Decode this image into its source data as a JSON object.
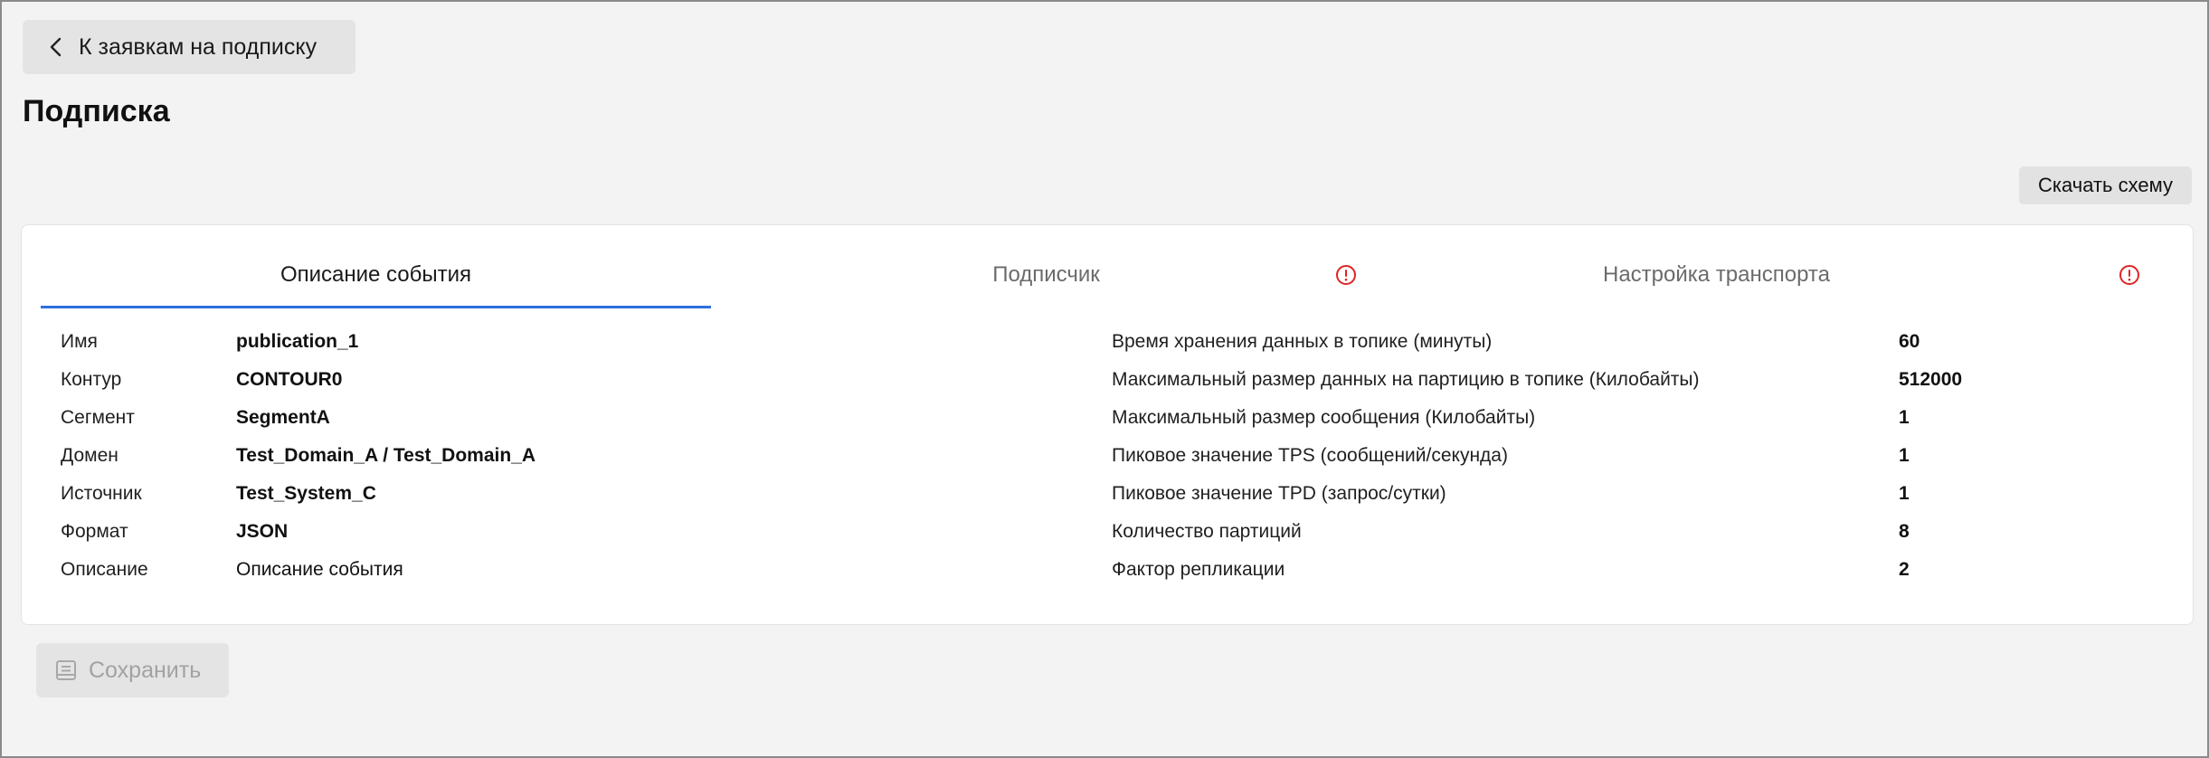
{
  "back_button": {
    "label": "К заявкам на подписку",
    "icon": "chevron-left-icon"
  },
  "page_title": "Подписка",
  "download_button": {
    "label": "Скачать схему"
  },
  "tabs": [
    {
      "label": "Описание события",
      "active": true,
      "warning": false
    },
    {
      "label": "Подписчик",
      "active": false,
      "warning": true,
      "warning_icon": "alert-circle-icon"
    },
    {
      "label": "Настройка транспорта",
      "active": false,
      "warning": true,
      "warning_icon": "alert-circle-icon"
    }
  ],
  "event_details": [
    {
      "label": "Имя",
      "value": "publication_1"
    },
    {
      "label": "Контур",
      "value": "CONTOUR0"
    },
    {
      "label": "Сегмент",
      "value": "SegmentA"
    },
    {
      "label": "Домен",
      "value": "Test_Domain_A / Test_Domain_A"
    },
    {
      "label": "Источник",
      "value": "Test_System_C"
    },
    {
      "label": "Формат",
      "value": "JSON"
    },
    {
      "label": "Описание",
      "value": "Описание события"
    }
  ],
  "topic_settings": [
    {
      "label": "Время хранения данных в топике (минуты)",
      "value": "60"
    },
    {
      "label": "Максимальный размер данных на партицию в топике (Килобайты)",
      "value": "512000"
    },
    {
      "label": "Максимальный размер сообщения (Килобайты)",
      "value": "1"
    },
    {
      "label": "Пиковое значение TPS (сообщений/секунда)",
      "value": "1"
    },
    {
      "label": "Пиковое значение TPD (запрос/сутки)",
      "value": "1"
    },
    {
      "label": "Количество партиций",
      "value": "8"
    },
    {
      "label": "Фактор репликации",
      "value": "2"
    }
  ],
  "save_button": {
    "label": "Сохранить",
    "disabled": true,
    "icon": "save-icon"
  },
  "colors": {
    "accent": "#2f6fdf",
    "warning": "#e02424",
    "disabled_text": "#a2a2a2"
  }
}
